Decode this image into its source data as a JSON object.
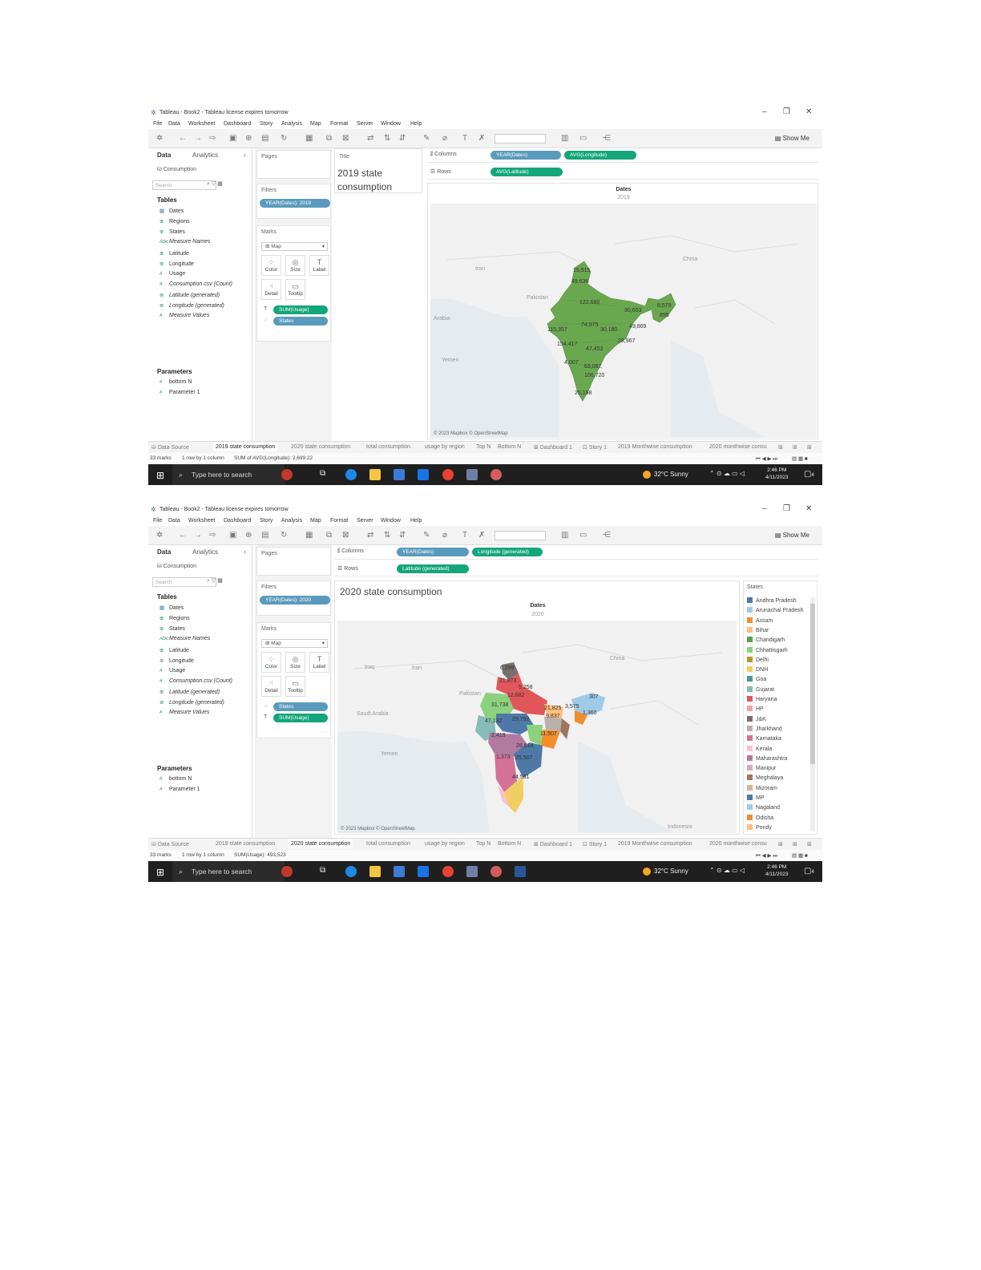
{
  "screens": [
    {
      "window_title": "Tableau - Book2 - Tableau license expires tomorrow",
      "menu": [
        "File",
        "Data",
        "Worksheet",
        "Dashboard",
        "Story",
        "Analysis",
        "Map",
        "Format",
        "Server",
        "Window",
        "Help"
      ],
      "show_me": "Show Me",
      "data_tab": "Data",
      "analytics_tab": "Analytics",
      "datasource": "Consumption",
      "search_placeholder": "Search",
      "tables_header": "Tables",
      "fields": [
        "Dates",
        "Regions",
        "States",
        "Measure Names",
        "Latitude",
        "Longitude",
        "Usage",
        "Consumption.csv (Count)",
        "Latitude (generated)",
        "Longitude (generated)",
        "Measure Values"
      ],
      "parameters_header": "Parameters",
      "parameters": [
        "bottom N",
        "Parameter 1"
      ],
      "pages_label": "Pages",
      "filters_label": "Filters",
      "filter_pill": "YEAR(Dates): 2019",
      "marks_label": "Marks",
      "mark_type": "Map",
      "mark_buttons": [
        "Color",
        "Size",
        "Label",
        "Detail",
        "Tooltip"
      ],
      "mark_pills": [
        "SUM(Usage)",
        "States"
      ],
      "title_card_label": "Title",
      "title_text": "2019 state consumption",
      "columns_label": "Columns",
      "rows_label": "Rows",
      "columns_pills": [
        "YEAR(Dates)",
        "AVG(Longitude)"
      ],
      "rows_pills": [
        "AVG(Latitude)"
      ],
      "view_header": "Dates",
      "view_subheader": "2019",
      "map_place_labels": [
        "Iran",
        "China",
        "Pakistan",
        "Arabia",
        "Yemen"
      ],
      "map_values": [
        "15,915",
        "49,636",
        "122,680",
        "30,603",
        "8,579",
        "895",
        "74,975",
        "30,180",
        "49,869",
        "115,357",
        "154,417",
        "28,967",
        "47,453",
        "4,007",
        "63,097",
        "106,720",
        "25,198"
      ],
      "attribution": "© 2023 Mapbox © OpenStreetMap",
      "sheet_tabs": [
        "Data Source",
        "2019 state consumption",
        "2020 state consumption",
        "total consumption",
        "usage by region",
        "Top N",
        "Bottom N",
        "Dashboard 1",
        "Story 1",
        "2019 Monthwise consumption",
        "2020 monthwise consu"
      ],
      "active_tab": 1,
      "status": [
        "33 marks",
        "1 row by 1 column",
        "SUM of AVG(Longitude): 2,699.22"
      ],
      "taskbar_search": "Type here to search",
      "weather": "32°C  Sunny",
      "clock_time": "2:46 PM",
      "clock_date": "4/11/2023",
      "notifications": "4"
    },
    {
      "window_title": "Tableau - Book2 - Tableau license expires tomorrow",
      "menu": [
        "File",
        "Data",
        "Worksheet",
        "Dashboard",
        "Story",
        "Analysis",
        "Map",
        "Format",
        "Server",
        "Window",
        "Help"
      ],
      "show_me": "Show Me",
      "data_tab": "Data",
      "analytics_tab": "Analytics",
      "datasource": "Consumption",
      "search_placeholder": "Search",
      "tables_header": "Tables",
      "fields": [
        "Dates",
        "Regions",
        "States",
        "Measure Names",
        "Latitude",
        "Longitude",
        "Usage",
        "Consumption.csv (Count)",
        "Latitude (generated)",
        "Longitude (generated)",
        "Measure Values"
      ],
      "parameters_header": "Parameters",
      "parameters": [
        "bottom N",
        "Parameter 1"
      ],
      "pages_label": "Pages",
      "filters_label": "Filters",
      "filter_pill": "YEAR(Dates): 2020",
      "marks_label": "Marks",
      "mark_type": "Map",
      "mark_buttons": [
        "Color",
        "Size",
        "Label",
        "Detail",
        "Tooltip"
      ],
      "mark_pills": [
        "States",
        "SUM(Usage)"
      ],
      "title_text": "2020 state consumption",
      "columns_label": "Columns",
      "rows_label": "Rows",
      "columns_pills": [
        "YEAR(Dates)",
        "Longitude (generated)"
      ],
      "rows_pills": [
        "Latitude (generated)"
      ],
      "view_header": "Dates",
      "view_subheader": "2020",
      "map_place_labels": [
        "Iraq",
        "Iran",
        "China",
        "Pakistan",
        "Saudi Arabia",
        "Yemen",
        "Indonesia"
      ],
      "map_values": [
        "6,299",
        "21,873",
        "5,258",
        "12,682",
        "31,738",
        "21,825",
        "3,575",
        "307",
        "47,132",
        "29,792",
        "9,837",
        "1,360",
        "11,507",
        "2,419",
        "26,614",
        "1,373",
        "25,507",
        "44,581"
      ],
      "legend_title": "States",
      "legend_items": [
        {
          "name": "Andhra Pradesh",
          "color": "#4e79a7"
        },
        {
          "name": "Arunachal Pradesh",
          "color": "#a0cbe8"
        },
        {
          "name": "Assam",
          "color": "#f28e2b"
        },
        {
          "name": "Bihar",
          "color": "#ffbe7d"
        },
        {
          "name": "Chandigarh",
          "color": "#59a14f"
        },
        {
          "name": "Chhattisgarh",
          "color": "#8cd17d"
        },
        {
          "name": "Delhi",
          "color": "#b6992d"
        },
        {
          "name": "DNH",
          "color": "#f1ce63"
        },
        {
          "name": "Goa",
          "color": "#499894"
        },
        {
          "name": "Gujarat",
          "color": "#86bcb6"
        },
        {
          "name": "Haryana",
          "color": "#e15759"
        },
        {
          "name": "HP",
          "color": "#ff9d9a"
        },
        {
          "name": "J&K",
          "color": "#79706e"
        },
        {
          "name": "Jharkhand",
          "color": "#bab0ac"
        },
        {
          "name": "Karnataka",
          "color": "#d37295"
        },
        {
          "name": "Kerala",
          "color": "#fabfd2"
        },
        {
          "name": "Maharashtra",
          "color": "#b07aa1"
        },
        {
          "name": "Manipur",
          "color": "#d4a6c8"
        },
        {
          "name": "Meghalaya",
          "color": "#9d7660"
        },
        {
          "name": "Mizoram",
          "color": "#d7b5a6"
        },
        {
          "name": "MP",
          "color": "#4e79a7"
        },
        {
          "name": "Nagaland",
          "color": "#a0cbe8"
        },
        {
          "name": "Odisha",
          "color": "#f28e2b"
        },
        {
          "name": "Pondy",
          "color": "#ffbe7d"
        }
      ],
      "attribution": "© 2023 Mapbox © OpenStreetMap",
      "sheet_tabs": [
        "Data Source",
        "2019 state consumption",
        "2020 state consumption",
        "total consumption",
        "usage by region",
        "Top N",
        "Bottom N",
        "Dashboard 1",
        "Story 1",
        "2019 Monthwise consumption",
        "2020 monthwise consu"
      ],
      "active_tab": 2,
      "status": [
        "33 marks",
        "1 row by 1 column",
        "SUM(Usage): 493,523"
      ],
      "taskbar_search": "Type here to search",
      "weather": "32°C  Sunny",
      "clock_time": "2:46 PM",
      "clock_date": "4/11/2023",
      "notifications": "4"
    }
  ],
  "colors": {
    "map_fill_2019": "#6aa84f",
    "pill_dimension": "#5a9bbd",
    "pill_measure": "#14a67a"
  }
}
